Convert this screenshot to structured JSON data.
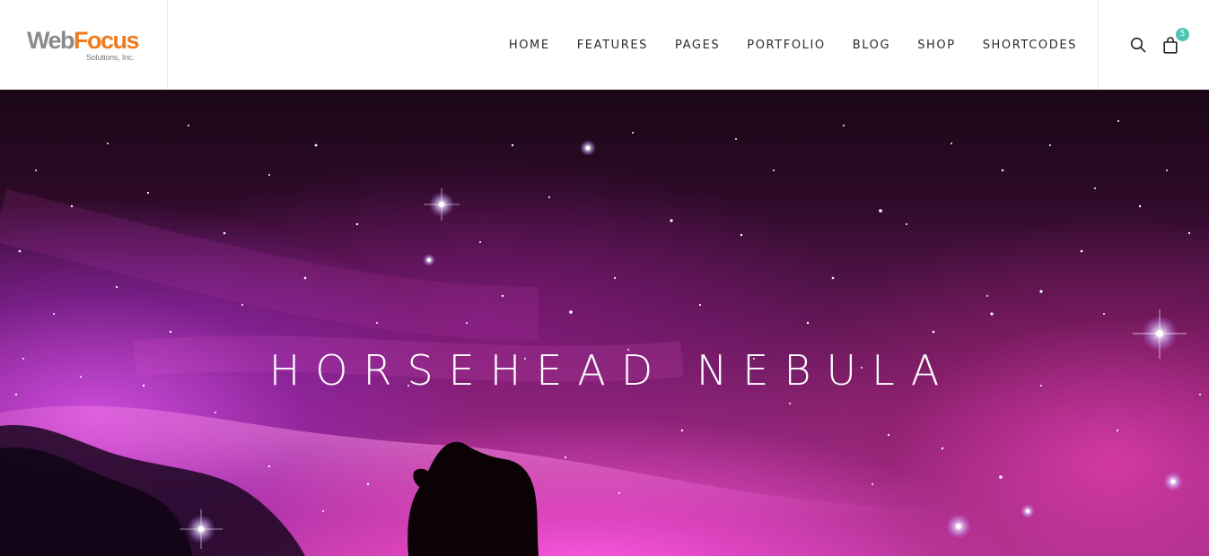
{
  "brand": {
    "name_part1": "Web",
    "name_part2": "Focus",
    "tagline": "Solutions, Inc.",
    "colors": {
      "web": "#8a8a8a",
      "focus": "#f07a1c"
    }
  },
  "nav": {
    "items": [
      {
        "label": "HOME"
      },
      {
        "label": "FEATURES"
      },
      {
        "label": "PAGES"
      },
      {
        "label": "PORTFOLIO"
      },
      {
        "label": "BLOG"
      },
      {
        "label": "SHOP"
      },
      {
        "label": "SHORTCODES"
      }
    ]
  },
  "tools": {
    "search_icon": "search-icon",
    "cart_icon": "shopping-bag-icon",
    "cart_count": "5",
    "badge_color": "#4cc6b2"
  },
  "hero": {
    "title": "HORSEHEAD NEBULA"
  }
}
